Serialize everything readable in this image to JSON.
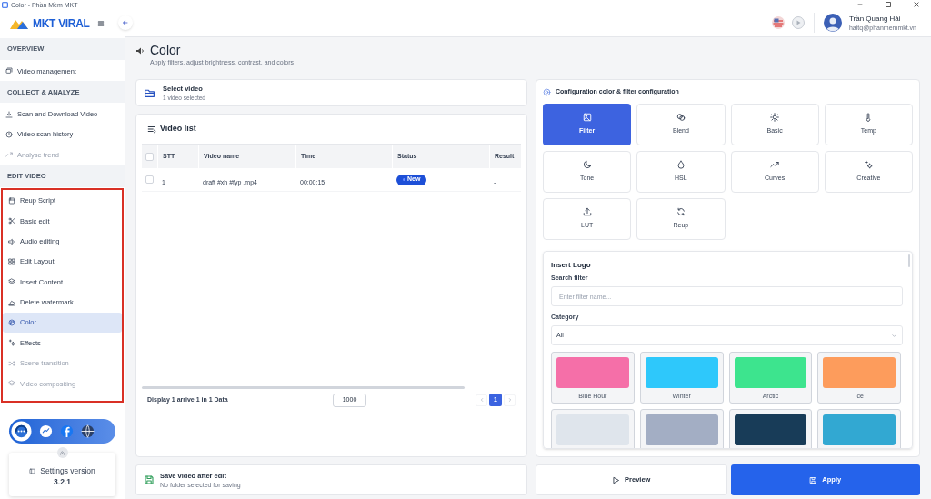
{
  "window": {
    "title": "Color - Phần Mềm MKT"
  },
  "sidebar": {
    "logo": "MKT VIRAL",
    "sections": [
      {
        "title": "OVERVIEW",
        "items": [
          {
            "label": "Video management",
            "selected": false,
            "disabled": false
          }
        ]
      },
      {
        "title": "COLLECT & ANALYZE",
        "items": [
          {
            "label": "Scan and Download Video",
            "selected": false,
            "disabled": false
          },
          {
            "label": "Video scan history",
            "selected": false,
            "disabled": false
          },
          {
            "label": "Analyse trend",
            "selected": false,
            "disabled": true
          }
        ]
      },
      {
        "title": "EDIT VIDEO",
        "highlighted": true,
        "items": [
          {
            "label": "Reup Script",
            "selected": false,
            "disabled": false
          },
          {
            "label": "Basic edit",
            "selected": false,
            "disabled": false
          },
          {
            "label": "Audio editing",
            "selected": false,
            "disabled": false
          },
          {
            "label": "Edit Layout",
            "selected": false,
            "disabled": false
          },
          {
            "label": "Insert Content",
            "selected": false,
            "disabled": false
          },
          {
            "label": "Delete watermark",
            "selected": false,
            "disabled": false
          },
          {
            "label": "Color",
            "selected": true,
            "disabled": false
          },
          {
            "label": "Effects",
            "selected": false,
            "disabled": false
          },
          {
            "label": "Scene transition",
            "selected": false,
            "disabled": true
          },
          {
            "label": "Video compositing",
            "selected": false,
            "disabled": true
          }
        ]
      }
    ],
    "settings": {
      "title": "Settings version",
      "version": "3.2.1"
    }
  },
  "user": {
    "name": "Trần Quang Hải",
    "email": "haitq@phanmemmkt.vn"
  },
  "page": {
    "title": "Color",
    "subtitle": "Apply filters, adjust brightness, contrast, and colors"
  },
  "select_video": {
    "title": "Select video",
    "subtitle": "1 video selected"
  },
  "video_list": {
    "title": "Video list",
    "columns": [
      "STT",
      "Video name",
      "Time",
      "Status",
      "Result"
    ],
    "all_checked": false,
    "rows": [
      {
        "checked": false,
        "stt": "1",
        "name": "draft #xh #fyp .mp4",
        "time": "00:00:15",
        "status": "New",
        "result": "-"
      }
    ],
    "summary": "Display 1 arrive 1 in 1 Data",
    "page_size": "1000",
    "pages": [
      {
        "label": "1",
        "selected": true
      }
    ]
  },
  "save": {
    "title": "Save video after edit",
    "subtitle": "No folder selected for saving"
  },
  "config": {
    "title": "Configuration color & filter configuration",
    "tabs": [
      {
        "label": "Filter",
        "selected": true
      },
      {
        "label": "Blend",
        "selected": false
      },
      {
        "label": "Basic",
        "selected": false
      },
      {
        "label": "Temp",
        "selected": false
      },
      {
        "label": "Tone",
        "selected": false
      },
      {
        "label": "HSL",
        "selected": false
      },
      {
        "label": "Curves",
        "selected": false
      },
      {
        "label": "Creative",
        "selected": false
      },
      {
        "label": "LUT",
        "selected": false
      },
      {
        "label": "Reup",
        "selected": false
      }
    ]
  },
  "insert_logo": {
    "title": "Insert Logo",
    "search_label": "Search filter",
    "search_placeholder": "Enter filter name...",
    "category_label": "Category",
    "category_value": "All",
    "swatches": [
      {
        "label": "Blue Hour",
        "color": "#f56fa8"
      },
      {
        "label": "Winter",
        "color": "#2ec8fb"
      },
      {
        "label": "Arctic",
        "color": "#3de48e"
      },
      {
        "label": "Ice",
        "color": "#fd9c5c"
      },
      {
        "color": "#dfe5ec"
      },
      {
        "color": "#a3aec4"
      },
      {
        "color": "#183c58"
      },
      {
        "color": "#32a8d2"
      }
    ]
  },
  "actions": [
    {
      "label": "Preview",
      "kind": "secondary"
    },
    {
      "label": "Apply",
      "kind": "primary"
    }
  ]
}
